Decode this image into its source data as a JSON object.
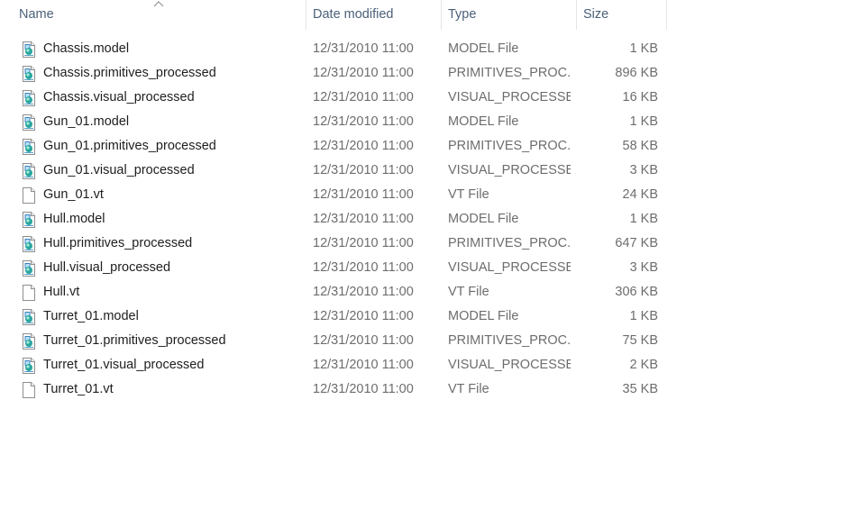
{
  "columns": {
    "name": "Name",
    "date": "Date modified",
    "type": "Type",
    "size": "Size"
  },
  "files": [
    {
      "name": "Chassis.model",
      "date": "12/31/2010 11:00",
      "type": "MODEL File",
      "size": "1 KB",
      "icon": "model-file-icon"
    },
    {
      "name": "Chassis.primitives_processed",
      "date": "12/31/2010 11:00",
      "type": "PRIMITIVES_PROC...",
      "size": "896 KB",
      "icon": "model-file-icon"
    },
    {
      "name": "Chassis.visual_processed",
      "date": "12/31/2010 11:00",
      "type": "VISUAL_PROCESSE...",
      "size": "16 KB",
      "icon": "model-file-icon"
    },
    {
      "name": "Gun_01.model",
      "date": "12/31/2010 11:00",
      "type": "MODEL File",
      "size": "1 KB",
      "icon": "model-file-icon"
    },
    {
      "name": "Gun_01.primitives_processed",
      "date": "12/31/2010 11:00",
      "type": "PRIMITIVES_PROC...",
      "size": "58 KB",
      "icon": "model-file-icon"
    },
    {
      "name": "Gun_01.visual_processed",
      "date": "12/31/2010 11:00",
      "type": "VISUAL_PROCESSE...",
      "size": "3 KB",
      "icon": "model-file-icon"
    },
    {
      "name": "Gun_01.vt",
      "date": "12/31/2010 11:00",
      "type": "VT File",
      "size": "24 KB",
      "icon": "blank-file-icon"
    },
    {
      "name": "Hull.model",
      "date": "12/31/2010 11:00",
      "type": "MODEL File",
      "size": "1 KB",
      "icon": "model-file-icon"
    },
    {
      "name": "Hull.primitives_processed",
      "date": "12/31/2010 11:00",
      "type": "PRIMITIVES_PROC...",
      "size": "647 KB",
      "icon": "model-file-icon"
    },
    {
      "name": "Hull.visual_processed",
      "date": "12/31/2010 11:00",
      "type": "VISUAL_PROCESSE...",
      "size": "3 KB",
      "icon": "model-file-icon"
    },
    {
      "name": "Hull.vt",
      "date": "12/31/2010 11:00",
      "type": "VT File",
      "size": "306 KB",
      "icon": "blank-file-icon"
    },
    {
      "name": "Turret_01.model",
      "date": "12/31/2010 11:00",
      "type": "MODEL File",
      "size": "1 KB",
      "icon": "model-file-icon"
    },
    {
      "name": "Turret_01.primitives_processed",
      "date": "12/31/2010 11:00",
      "type": "PRIMITIVES_PROC...",
      "size": "75 KB",
      "icon": "model-file-icon"
    },
    {
      "name": "Turret_01.visual_processed",
      "date": "12/31/2010 11:00",
      "type": "VISUAL_PROCESSE...",
      "size": "2 KB",
      "icon": "model-file-icon"
    },
    {
      "name": "Turret_01.vt",
      "date": "12/31/2010 11:00",
      "type": "VT File",
      "size": "35 KB",
      "icon": "blank-file-icon"
    }
  ],
  "colors": {
    "header_text": "#4c607a",
    "name_text": "#1e1e1e",
    "detail_text": "#6d6d6d",
    "column_divider": "#e5e5e5",
    "icon_accent": "#2aa6a0"
  }
}
